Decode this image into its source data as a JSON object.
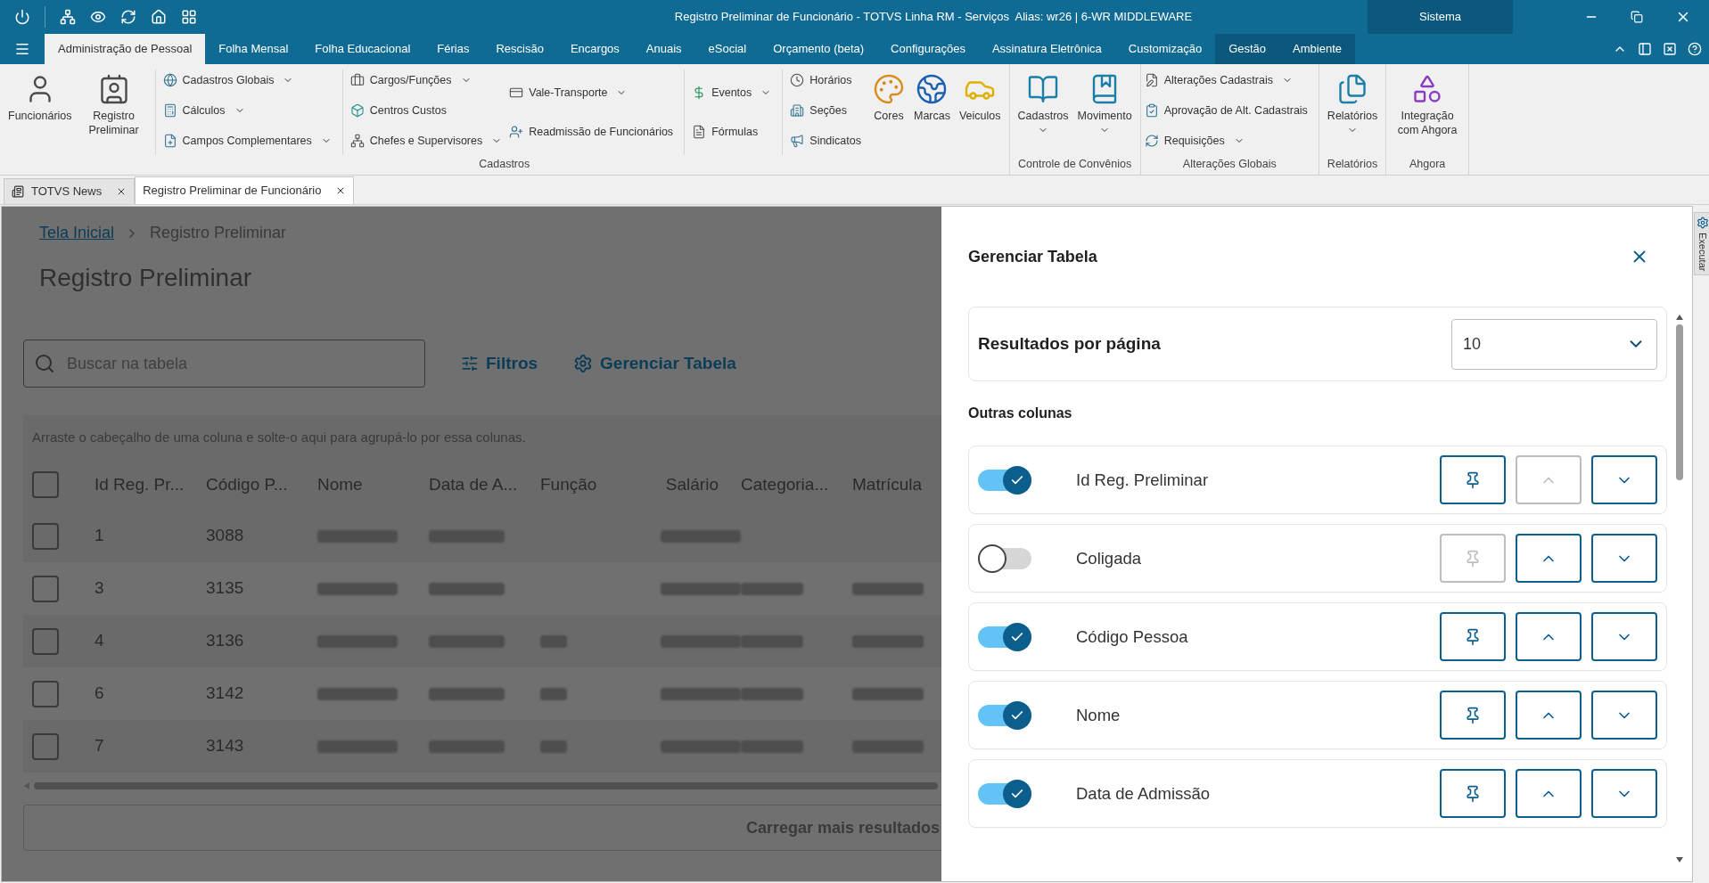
{
  "title_bar": {
    "title": "Registro Preliminar de Funcionário - TOTVS Linha RM - Serviços  Alias: wr26 | 6-WR MIDDLEWARE",
    "context_label": "Sistema"
  },
  "ribbon_tabs": [
    {
      "label": "Administração de Pessoal",
      "selected": true,
      "contextual": false
    },
    {
      "label": "Folha Mensal",
      "selected": false,
      "contextual": false
    },
    {
      "label": "Folha Educacional",
      "selected": false,
      "contextual": false
    },
    {
      "label": "Férias",
      "selected": false,
      "contextual": false
    },
    {
      "label": "Rescisão",
      "selected": false,
      "contextual": false
    },
    {
      "label": "Encargos",
      "selected": false,
      "contextual": false
    },
    {
      "label": "Anuais",
      "selected": false,
      "contextual": false
    },
    {
      "label": "eSocial",
      "selected": false,
      "contextual": false
    },
    {
      "label": "Orçamento (beta)",
      "selected": false,
      "contextual": false
    },
    {
      "label": "Configurações",
      "selected": false,
      "contextual": false
    },
    {
      "label": "Assinatura Eletrônica",
      "selected": false,
      "contextual": false
    },
    {
      "label": "Customização",
      "selected": false,
      "contextual": false
    },
    {
      "label": "Gestão",
      "selected": false,
      "contextual": true
    },
    {
      "label": "Ambiente",
      "selected": false,
      "contextual": true
    }
  ],
  "ribbon_groups": [
    {
      "label": "Cadastros",
      "columns": [
        {
          "kind": "large",
          "items": [
            {
              "label": "Funcionários",
              "dropdown": false
            }
          ]
        },
        {
          "kind": "large",
          "items": [
            {
              "label": "Registro Preliminar",
              "dropdown": false
            }
          ]
        },
        {
          "kind": "small",
          "divider": true,
          "items": [
            {
              "label": "Cadastros Globais",
              "dropdown": true
            },
            {
              "label": "Cálculos",
              "dropdown": true
            },
            {
              "label": "Campos Complementares",
              "dropdown": true
            }
          ]
        },
        {
          "kind": "small",
          "divider": true,
          "items": [
            {
              "label": "Cargos/Funções",
              "dropdown": true
            },
            {
              "label": "Centros Custos",
              "dropdown": false
            },
            {
              "label": "Chefes e Supervisores",
              "dropdown": true
            }
          ]
        },
        {
          "kind": "small",
          "divider": false,
          "items": [
            {
              "label": "Vale-Transporte",
              "dropdown": true
            },
            {
              "label": "Readmissão de Funcionários",
              "dropdown": false
            }
          ]
        },
        {
          "kind": "small",
          "divider": true,
          "items": [
            {
              "label": "Eventos",
              "dropdown": true
            },
            {
              "label": "Fórmulas",
              "dropdown": false
            }
          ]
        },
        {
          "kind": "small",
          "divider": true,
          "items": [
            {
              "label": "Horários",
              "dropdown": false
            },
            {
              "label": "Seções",
              "dropdown": false
            },
            {
              "label": "Sindicatos",
              "dropdown": false
            }
          ]
        },
        {
          "kind": "large",
          "items": [
            {
              "label": "Cores",
              "dropdown": false
            }
          ]
        },
        {
          "kind": "large",
          "items": [
            {
              "label": "Marcas",
              "dropdown": false
            }
          ]
        },
        {
          "kind": "large",
          "items": [
            {
              "label": "Veiculos",
              "dropdown": false
            }
          ]
        }
      ]
    },
    {
      "label": "Controle de Convênios",
      "columns": [
        {
          "kind": "large",
          "items": [
            {
              "label": "Cadastros",
              "dropdown": true
            }
          ]
        },
        {
          "kind": "large",
          "items": [
            {
              "label": "Movimento",
              "dropdown": true
            }
          ]
        }
      ]
    },
    {
      "label": "Alterações Globais",
      "columns": [
        {
          "kind": "small",
          "divider": false,
          "items": [
            {
              "label": "Alterações Cadastrais",
              "dropdown": true
            },
            {
              "label": "Aprovação de Alt. Cadastrais",
              "dropdown": false
            },
            {
              "label": "Requisições",
              "dropdown": true
            }
          ]
        }
      ]
    },
    {
      "label": "Relatórios",
      "columns": [
        {
          "kind": "large",
          "items": [
            {
              "label": "Relatórios",
              "dropdown": true
            }
          ]
        }
      ]
    },
    {
      "label": "Ahgora",
      "columns": [
        {
          "kind": "large",
          "items": [
            {
              "label": "Integração com Ahgora",
              "dropdown": false
            }
          ]
        }
      ]
    }
  ],
  "doc_tabs": [
    {
      "label": "TOTVS News",
      "selected": false
    },
    {
      "label": "Registro Preliminar de Funcionário",
      "selected": true
    }
  ],
  "page": {
    "breadcrumb": [
      {
        "label": "Tela Inicial",
        "kind": "link"
      },
      {
        "label": "Registro Preliminar",
        "kind": "current"
      }
    ],
    "heading": "Registro Preliminar",
    "search": {
      "placeholder": "Buscar na tabela"
    },
    "filters_button": "Filtros",
    "manage_button": "Gerenciar Tabela",
    "group_hint": "Arraste o cabeçalho de uma coluna e solte-o aqui para agrupá-lo por essa colunas.",
    "table": {
      "columns": [
        "Id Reg. Pr...",
        "Código P...",
        "Nome",
        "Data de A...",
        "Função",
        "Salário",
        "Categoria...",
        "Matrícula"
      ],
      "header_checked": false,
      "rows": [
        {
          "checked": false,
          "id": "1",
          "code": "3088",
          "redacted_cells": [
            true,
            true,
            false,
            true,
            false,
            false
          ]
        },
        {
          "checked": false,
          "id": "3",
          "code": "3135",
          "redacted_cells": [
            true,
            true,
            false,
            true,
            true,
            true
          ]
        },
        {
          "checked": false,
          "id": "4",
          "code": "3136",
          "redacted_cells": [
            true,
            true,
            true,
            true,
            true,
            true
          ]
        },
        {
          "checked": false,
          "id": "6",
          "code": "3142",
          "redacted_cells": [
            true,
            true,
            true,
            true,
            true,
            true
          ]
        },
        {
          "checked": false,
          "id": "7",
          "code": "3143",
          "redacted_cells": [
            true,
            true,
            true,
            true,
            true,
            true
          ]
        }
      ]
    },
    "load_more": "Carregar mais resultados"
  },
  "panel": {
    "title": "Gerenciar Tabela",
    "page_size_label": "Resultados por página",
    "page_size_value": "10",
    "section_label": "Outras colunas",
    "columns": [
      {
        "label": "Id Reg. Preliminar",
        "on": true,
        "pin_enabled": true,
        "up_enabled": false,
        "down_enabled": true
      },
      {
        "label": "Coligada",
        "on": false,
        "pin_enabled": false,
        "up_enabled": true,
        "down_enabled": true
      },
      {
        "label": "Código Pessoa",
        "on": true,
        "pin_enabled": true,
        "up_enabled": true,
        "down_enabled": true
      },
      {
        "label": "Nome",
        "on": true,
        "pin_enabled": true,
        "up_enabled": true,
        "down_enabled": true
      },
      {
        "label": "Data de Admissão",
        "on": true,
        "pin_enabled": true,
        "up_enabled": true,
        "down_enabled": true
      }
    ]
  },
  "side_strip": {
    "label": "Executar"
  }
}
